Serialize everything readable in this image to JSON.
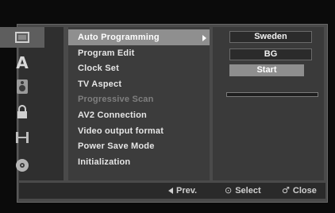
{
  "menu": {
    "items": [
      {
        "label": "Auto Programming",
        "state": "selected"
      },
      {
        "label": "Program Edit",
        "state": "normal"
      },
      {
        "label": "Clock Set",
        "state": "normal"
      },
      {
        "label": "TV Aspect",
        "state": "normal"
      },
      {
        "label": "Progressive Scan",
        "state": "disabled"
      },
      {
        "label": "AV2 Connection",
        "state": "normal"
      },
      {
        "label": "Video output format",
        "state": "normal"
      },
      {
        "label": "Power Save Mode",
        "state": "normal"
      },
      {
        "label": "Initialization",
        "state": "normal"
      }
    ]
  },
  "icons": [
    {
      "name": "general-settings-icon",
      "active": true
    },
    {
      "name": "language-icon",
      "glyph": "A",
      "active": false
    },
    {
      "name": "audio-icon",
      "active": false
    },
    {
      "name": "lock-icon",
      "active": false
    },
    {
      "name": "recording-icon",
      "active": false
    },
    {
      "name": "disc-icon",
      "active": false
    }
  ],
  "options": {
    "country": "Sweden",
    "system": "BG",
    "start_label": "Start",
    "progress": 0
  },
  "footer": {
    "prev_label": "Prev.",
    "select_symbol": "⊙",
    "select_label": "Select",
    "close_symbol": "♂",
    "close_label": "Close"
  },
  "colors": {
    "panel": "#4a4a4a",
    "selected_row": "#8f8f8f",
    "text": "#e6e6e6",
    "disabled_text": "#7f7f7f"
  }
}
